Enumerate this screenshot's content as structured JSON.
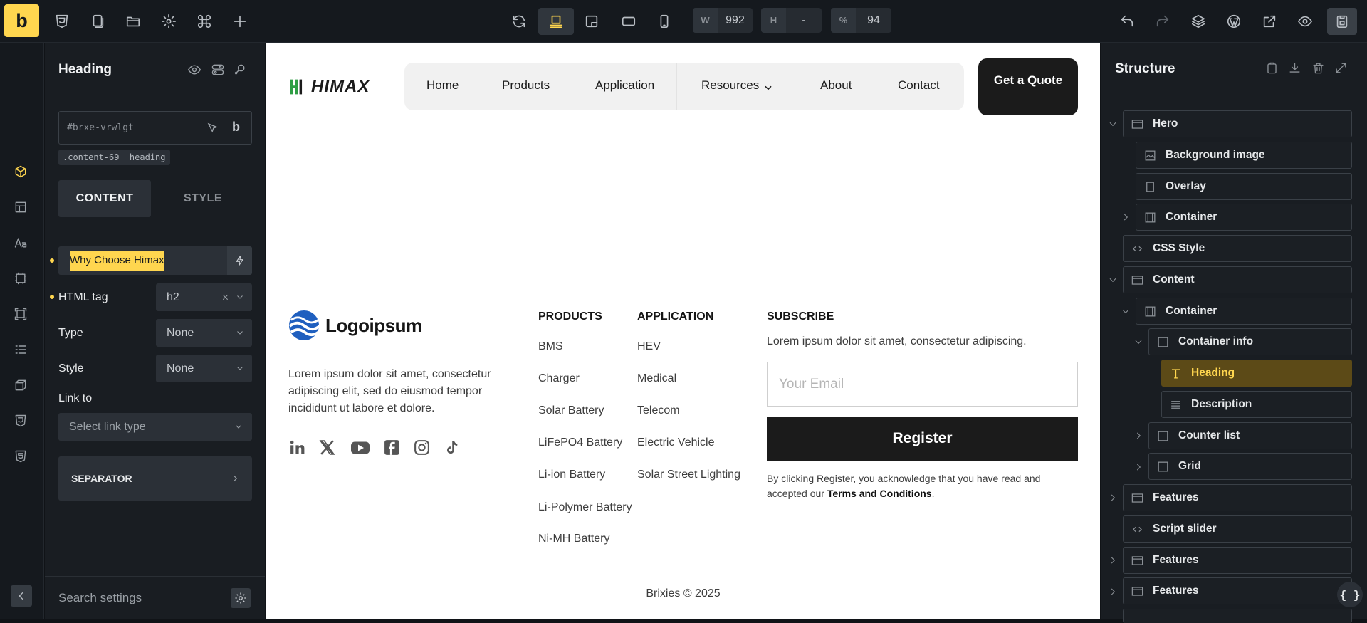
{
  "topbar": {
    "logo_letter": "b",
    "width": {
      "label": "W",
      "value": "992"
    },
    "height": {
      "label": "H",
      "value": "-"
    },
    "zoom": {
      "label": "%",
      "value": "94"
    }
  },
  "panel": {
    "title": "Heading",
    "element_id": "#brxe-vrwlgt",
    "id_badge": "b",
    "class_chip": ".content-69__heading",
    "tabs": {
      "content": "CONTENT",
      "style": "STYLE"
    },
    "text_value": "Why Choose Himax",
    "fields": {
      "html_tag": {
        "label": "HTML tag",
        "value": "h2"
      },
      "type": {
        "label": "Type",
        "value": "None"
      },
      "style": {
        "label": "Style",
        "value": "None"
      },
      "link_to": {
        "label": "Link to",
        "placeholder": "Select link type"
      }
    },
    "separator_label": "SEPARATOR",
    "search_placeholder": "Search settings"
  },
  "canvas": {
    "brand": "HIMAX",
    "nav": [
      "Home",
      "Products",
      "Application",
      "Resources",
      "About",
      "Contact"
    ],
    "cta": "Get a Quote",
    "footer": {
      "logo_text": "Logoipsum",
      "about": "Lorem ipsum dolor sit amet, consectetur adipiscing elit, sed do eiusmod tempor incididunt ut labore et dolore.",
      "products_title": "PRODUCTS",
      "products": [
        "BMS",
        "Charger",
        "Solar Battery",
        "LiFePO4 Battery",
        "Li-ion Battery",
        "Li-Polymer Battery",
        "Ni-MH Battery"
      ],
      "application_title": "APPLICATION",
      "applications": [
        "HEV",
        "Medical",
        "Telecom",
        "Electric Vehicle",
        "Solar Street Lighting"
      ],
      "subscribe_title": "SUBSCRIBE",
      "subscribe_text": "Lorem ipsum dolor sit amet, consectetur adipiscing.",
      "email_placeholder": "Your Email",
      "register_label": "Register",
      "consent_prefix": "By clicking Register, you acknowledge that you have read and accepted our",
      "consent_link": "Terms and Conditions",
      "consent_suffix": ".",
      "copyright": "Brixies © 2025",
      "social": [
        "linkedin-icon",
        "x-icon",
        "youtube-icon",
        "facebook-icon",
        "instagram-icon",
        "tiktok-icon"
      ]
    }
  },
  "structure": {
    "title": "Structure",
    "nodes": [
      {
        "label": "Hero",
        "icon": "section-icon"
      },
      {
        "label": "Background image",
        "icon": "image-icon"
      },
      {
        "label": "Overlay",
        "icon": "block-icon"
      },
      {
        "label": "Container",
        "icon": "container-icon"
      },
      {
        "label": "CSS Style",
        "icon": "code-icon"
      },
      {
        "label": "Content",
        "icon": "section-icon"
      },
      {
        "label": "Container",
        "icon": "container-icon"
      },
      {
        "label": "Container info",
        "icon": "box-icon"
      },
      {
        "label": "Heading",
        "icon": "heading-icon"
      },
      {
        "label": "Description",
        "icon": "text-icon"
      },
      {
        "label": "Counter list",
        "icon": "box-icon"
      },
      {
        "label": "Grid",
        "icon": "box-icon"
      },
      {
        "label": "Features",
        "icon": "section-icon"
      },
      {
        "label": "Script slider",
        "icon": "code-icon"
      },
      {
        "label": "Features",
        "icon": "section-icon"
      },
      {
        "label": "Features",
        "icon": "section-icon"
      }
    ]
  },
  "colors": {
    "accent": "#ffd64f",
    "dark": "#1b1b1b",
    "panel": "#191d22",
    "brand_green": "#3aa34a"
  }
}
